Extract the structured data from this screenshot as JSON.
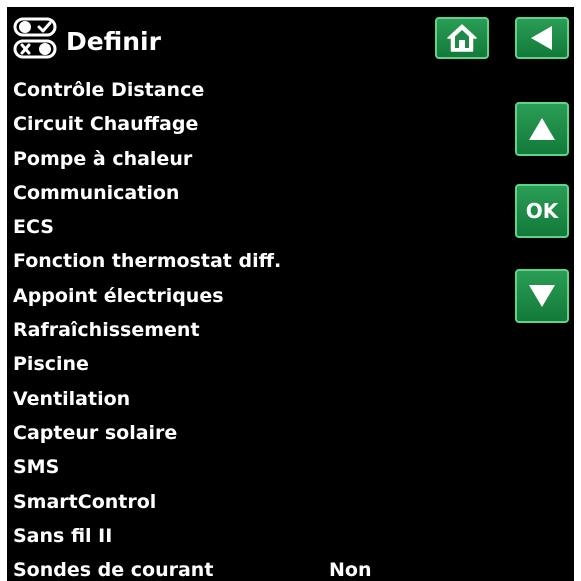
{
  "header": {
    "title": "Definir",
    "icon": "toggle-switches-icon"
  },
  "menu": {
    "items": [
      {
        "label": "Contrôle Distance",
        "value": ""
      },
      {
        "label": "Circuit Chauffage",
        "value": ""
      },
      {
        "label": "Pompe à chaleur",
        "value": ""
      },
      {
        "label": "Communication",
        "value": ""
      },
      {
        "label": "ECS",
        "value": ""
      },
      {
        "label": "Fonction thermostat diff.",
        "value": ""
      },
      {
        "label": "Appoint électriques",
        "value": ""
      },
      {
        "label": "Rafraîchissement",
        "value": ""
      },
      {
        "label": "Piscine",
        "value": ""
      },
      {
        "label": "Ventilation",
        "value": ""
      },
      {
        "label": "Capteur solaire",
        "value": ""
      },
      {
        "label": "SMS",
        "value": ""
      },
      {
        "label": "SmartControl",
        "value": ""
      },
      {
        "label": "Sans fil II",
        "value": ""
      },
      {
        "label": "Sondes de courant",
        "value": "Non"
      }
    ]
  },
  "buttons": {
    "home": {
      "icon": "home-icon"
    },
    "back": {
      "icon": "back-arrow-icon"
    },
    "up": {
      "icon": "up-arrow-icon"
    },
    "ok": {
      "label": "OK"
    },
    "down": {
      "icon": "down-arrow-icon"
    }
  },
  "colors": {
    "background": "#000000",
    "text": "#ffffff",
    "button": "#1f8a48",
    "button_border": "#5fd38c"
  }
}
